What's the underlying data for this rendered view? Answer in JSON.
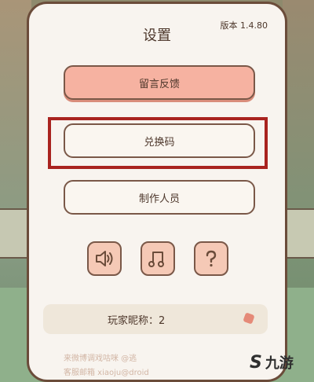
{
  "settings": {
    "title": "设置",
    "version": "版本 1.4.80",
    "buttons": {
      "feedback": "留言反馈",
      "redeem": "兑换码",
      "credits": "制作人员"
    },
    "icons": [
      "sound-icon",
      "music-icon",
      "help-icon"
    ],
    "nickname_label": "玩家昵称：2",
    "footer_weibo": "来微博调戏咕咪 @逃",
    "footer_email": "客服邮箱 xiaoju@droid"
  },
  "watermark": {
    "logo": "S",
    "text": "九游"
  },
  "colors": {
    "accent": "#f6b2a1",
    "highlight": "#a9231f",
    "border": "#7a5848",
    "text": "#4d372b"
  }
}
